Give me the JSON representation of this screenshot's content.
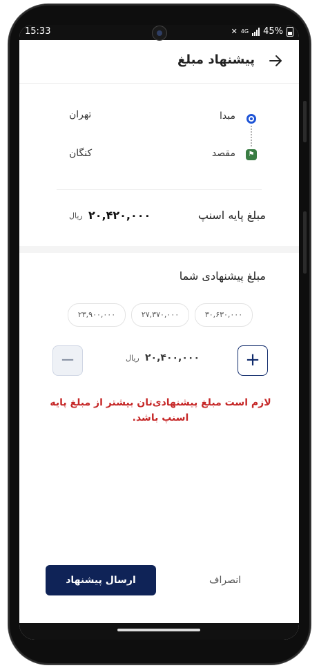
{
  "status_bar": {
    "time": "15:33",
    "network": "4G",
    "battery": "45%"
  },
  "header": {
    "title": "پیشنهاد مبلغ",
    "back_icon": "arrow-right-icon"
  },
  "route": {
    "origin_label": "مبدا",
    "origin_value": "تهران",
    "destination_label": "مقصد",
    "destination_value": "کنگان"
  },
  "base_price": {
    "label": "مبلغ پایه اسنپ",
    "amount": "۲۰,۴۲۰,۰۰۰",
    "unit": "ریال"
  },
  "offer": {
    "title": "مبلغ پیشنهادی شما",
    "suggestions": [
      "۳۰,۶۳۰,۰۰۰",
      "۲۷,۳۷۰,۰۰۰",
      "۲۳,۹۰۰,۰۰۰"
    ],
    "amount": "۲۰,۴۰۰,۰۰۰",
    "unit": "ریال",
    "plus": "+",
    "minus": "−",
    "error": "لازم است مبلغ پیشنهادی‌تان بیشتر از مبلغ پایه اسنپ باشد."
  },
  "actions": {
    "send": "ارسال پیشنهاد",
    "cancel": "انصراف"
  },
  "colors": {
    "accent": "#0f2357",
    "error": "#c62828",
    "origin": "#1e54d6",
    "destination": "#3a7d44"
  }
}
